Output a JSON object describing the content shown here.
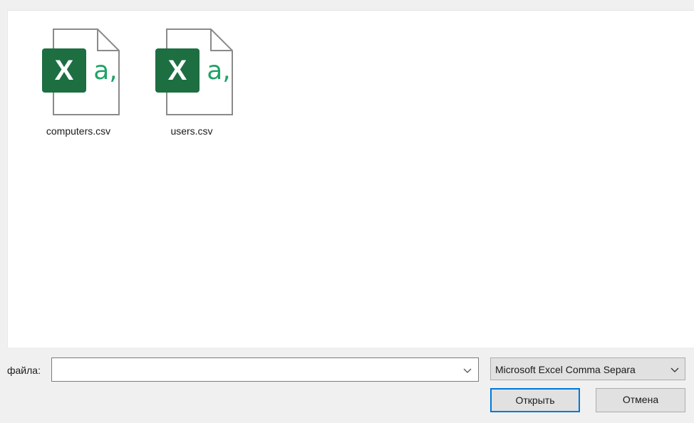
{
  "files": [
    {
      "name": "computers.csv",
      "icon": "excel-csv-file-icon"
    },
    {
      "name": "users.csv",
      "icon": "excel-csv-file-icon"
    }
  ],
  "icon_glyphs": {
    "excel_letter": "X",
    "csv_mark": "a,"
  },
  "bottom_bar": {
    "filename_label": "файла:",
    "filename_value": "",
    "filetype_selected": "Microsoft Excel Comma Separa",
    "open_button": "Открыть",
    "cancel_button": "Отмена"
  },
  "colors": {
    "excel_green": "#1d6f42",
    "csv_accent": "#21a366",
    "focus_blue": "#0078d7"
  }
}
